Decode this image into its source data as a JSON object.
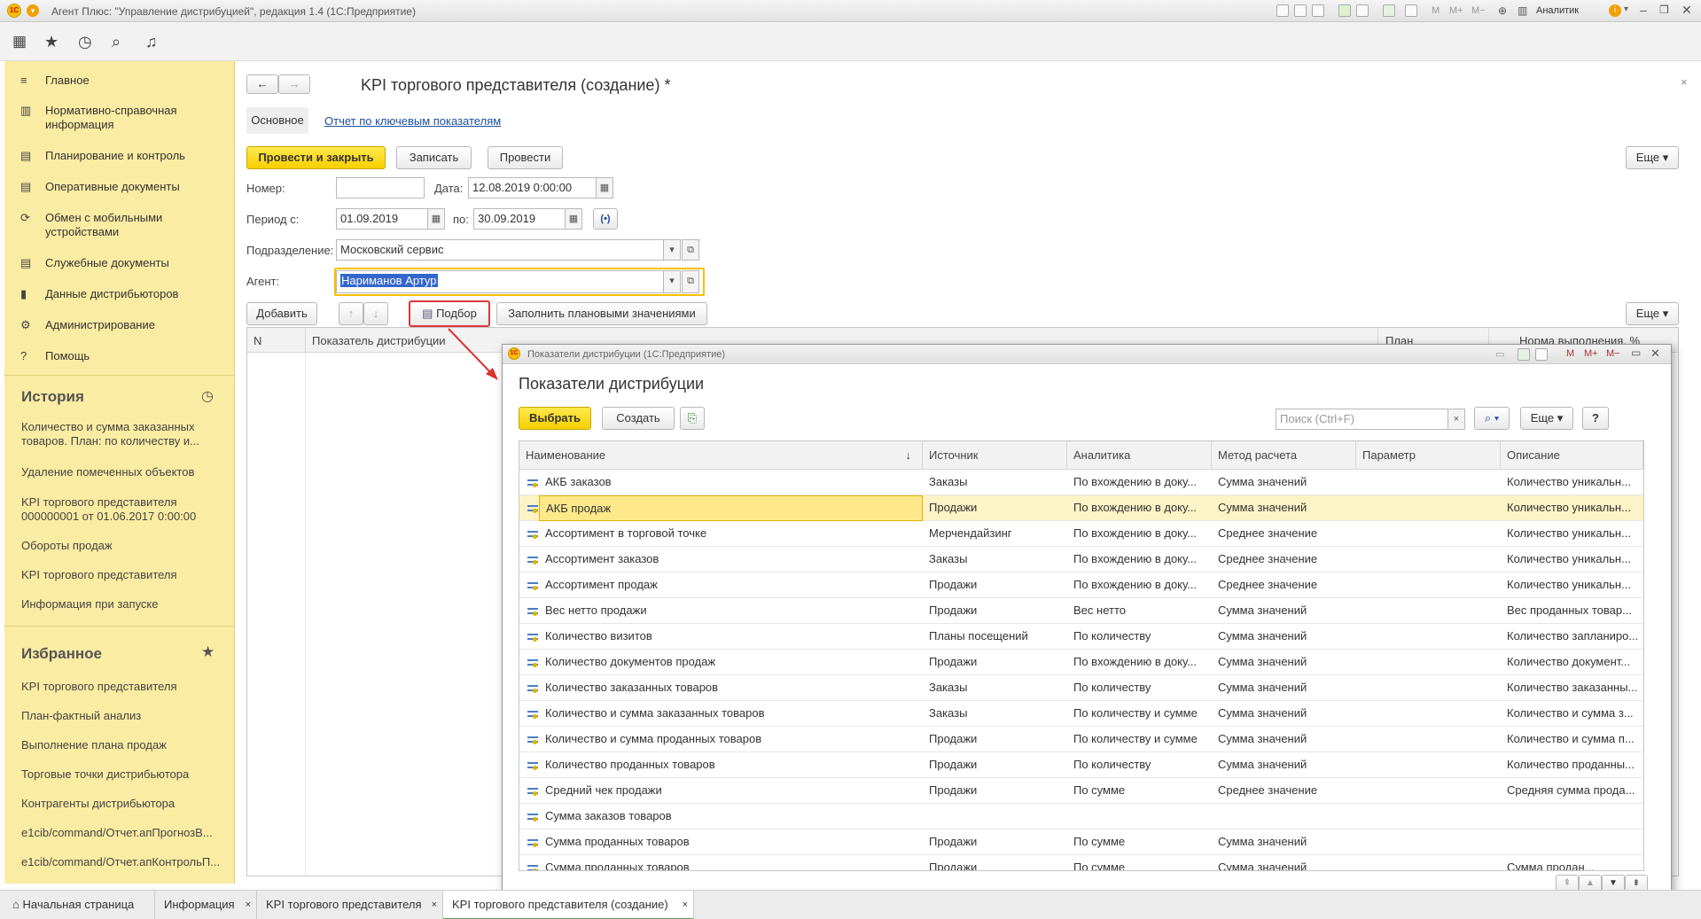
{
  "window": {
    "title": "Агент Плюс: \"Управление дистрибуцией\", редакция 1.4  (1С:Предприятие)",
    "user": "Аналитик"
  },
  "sidebar": {
    "items": [
      {
        "label": "Главное",
        "icon": "menu-icon"
      },
      {
        "label": "Нормативно-справочная информация",
        "icon": "reference-icon"
      },
      {
        "label": "Планирование и контроль",
        "icon": "planning-icon"
      },
      {
        "label": "Оперативные документы",
        "icon": "documents-icon"
      },
      {
        "label": "Обмен с мобильными устройствами",
        "icon": "sync-icon"
      },
      {
        "label": "Служебные документы",
        "icon": "service-docs-icon"
      },
      {
        "label": "Данные дистрибьюторов",
        "icon": "data-icon"
      },
      {
        "label": "Администрирование",
        "icon": "gear-icon"
      },
      {
        "label": "Помощь",
        "icon": "help-icon"
      }
    ],
    "history": {
      "title": "История",
      "items": [
        "Количество и сумма заказанных товаров.    План: по количеству и...",
        "Удаление помеченных объектов",
        "KPI торгового представителя 000000001 от 01.06.2017 0:00:00",
        "Обороты продаж",
        "KPI торгового представителя",
        "Информация при запуске"
      ]
    },
    "favorites": {
      "title": "Избранное",
      "items": [
        "KPI торгового представителя",
        "План-фактный анализ",
        "Выполнение плана продаж",
        "Торговые точки дистрибьютора",
        "Контрагенты дистрибьютора",
        "e1cib/command/Отчет.апПрогнозВ...",
        "e1cib/command/Отчет.апКонтрольП..."
      ]
    }
  },
  "form": {
    "title": "KPI торгового представителя (создание) *",
    "tabs": {
      "main": "Основное",
      "report": "Отчет по ключевым показателям"
    },
    "buttons": {
      "post_close": "Провести и закрыть",
      "save": "Записать",
      "post": "Провести",
      "more": "Еще",
      "add": "Добавить",
      "pick": "Подбор",
      "fill": "Заполнить плановыми значениями"
    },
    "fields": {
      "number_label": "Номер:",
      "number": "",
      "date_label": "Дата:",
      "date": "12.08.2019  0:00:00",
      "period_label": "Период с:",
      "period_from": "01.09.2019",
      "period_to_label": "по:",
      "period_to": "30.09.2019",
      "department_label": "Подразделение:",
      "department": "Московский сервис",
      "agent_label": "Агент:",
      "agent": "Нариманов Артур"
    },
    "table_headers": {
      "n": "N",
      "indicator": "Показатель дистрибуции",
      "plan": "План",
      "norm": "Норма выполнения, %"
    }
  },
  "popup": {
    "window_title": "Показатели дистрибуции  (1С:Предприятие)",
    "title": "Показатели дистрибуции",
    "buttons": {
      "select": "Выбрать",
      "create": "Создать",
      "more": "Еще",
      "help": "?"
    },
    "search_placeholder": "Поиск (Ctrl+F)",
    "columns": [
      "Наименование",
      "Источник",
      "Аналитика",
      "Метод расчета",
      "Параметр",
      "Описание"
    ],
    "rows": [
      [
        "АКБ заказов",
        "Заказы",
        "По вхождению в доку...",
        "Сумма значений",
        "",
        "Количество уникальн..."
      ],
      [
        "АКБ продаж",
        "Продажи",
        "По вхождению в доку...",
        "Сумма значений",
        "",
        "Количество уникальн..."
      ],
      [
        "Ассортимент в торговой точке",
        "Мерчендайзинг",
        "По вхождению в доку...",
        "Среднее значение",
        "",
        "Количество уникальн..."
      ],
      [
        "Ассортимент заказов",
        "Заказы",
        "По вхождению в доку...",
        "Среднее значение",
        "",
        "Количество уникальн..."
      ],
      [
        "Ассортимент продаж",
        "Продажи",
        "По вхождению в доку...",
        "Среднее значение",
        "",
        "Количество уникальн..."
      ],
      [
        "Вес нетто продажи",
        "Продажи",
        "Вес нетто",
        "Сумма значений",
        "",
        "Вес проданных товар..."
      ],
      [
        "Количество визитов",
        "Планы посещений",
        "По количеству",
        "Сумма значений",
        "",
        "Количество запланиро..."
      ],
      [
        "Количество документов продаж",
        "Продажи",
        "По вхождению в доку...",
        "Сумма значений",
        "",
        "Количество документ..."
      ],
      [
        "Количество заказанных товаров",
        "Заказы",
        "По количеству",
        "Сумма значений",
        "",
        "Количество заказанны..."
      ],
      [
        "Количество и сумма заказанных товаров",
        "Заказы",
        "По количеству и сумме",
        "Сумма значений",
        "",
        "Количество и сумма з..."
      ],
      [
        "Количество и сумма проданных товаров",
        "Продажи",
        "По количеству и сумме",
        "Сумма значений",
        "",
        "Количество и сумма п..."
      ],
      [
        "Количество проданных товаров",
        "Продажи",
        "По количеству",
        "Сумма значений",
        "",
        "Количество проданны..."
      ],
      [
        "Средний чек продажи",
        "Продажи",
        "По сумме",
        "Среднее значение",
        "",
        "Средняя сумма прода..."
      ],
      [
        "Сумма заказов товаров",
        "",
        "",
        "",
        "",
        ""
      ],
      [
        "Сумма проданных товаров",
        "Продажи",
        "По сумме",
        "Сумма значений",
        "",
        ""
      ],
      [
        "Сумма проданных товаров",
        "Продажи",
        "По сумме",
        "Сумма значений",
        "",
        "Сумма продан..."
      ]
    ],
    "selected_row": 1
  },
  "tabbar": [
    "Начальная страница",
    "Информация",
    "KPI торгового представителя",
    "KPI торгового представителя (создание)"
  ],
  "colors": {
    "sidebar": "#fbeca3",
    "accent_button": "#f7cf00",
    "selected_row": "#fcf3c6",
    "link": "#1a4fa0",
    "highlight_border": "#d9363e"
  }
}
